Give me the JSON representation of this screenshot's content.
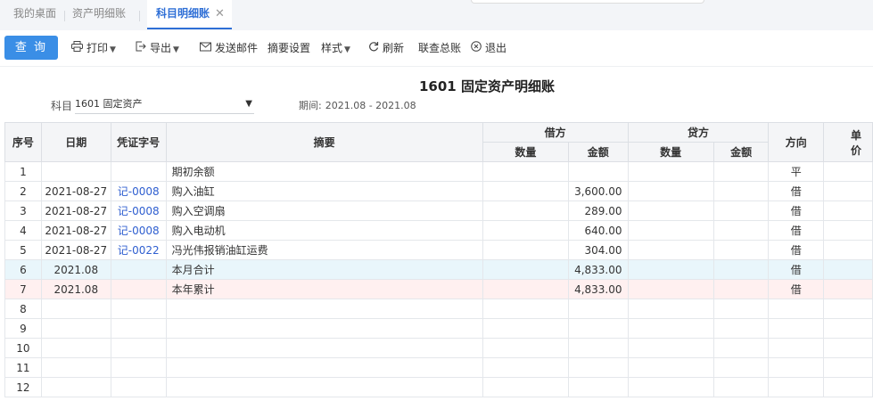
{
  "tabs": [
    {
      "label": "我的桌面"
    },
    {
      "label": "资产明细账"
    },
    {
      "label": "科目明细账",
      "close": "✕"
    }
  ],
  "toolbar": {
    "query": "查 询",
    "print": "打印",
    "export": "导出",
    "send_mail": "发送邮件",
    "summary_settings": "摘要设置",
    "style": "样式",
    "refresh": "刷新",
    "ledger": "联查总账",
    "exit": "退出"
  },
  "report": {
    "title": "1601 固定资产明细账",
    "subject_label": "科目",
    "subject_value": "1601 固定资产",
    "period_label": "期间:",
    "period_value": "2021.08 - 2021.08"
  },
  "table": {
    "headers": {
      "seq": "序号",
      "date": "日期",
      "voucher": "凭证字号",
      "summary": "摘要",
      "debit": "借方",
      "credit": "贷方",
      "qty": "数量",
      "amount": "金额",
      "direction": "方向",
      "unit": "单价"
    },
    "rows": [
      {
        "seq": "1",
        "date": "",
        "voucher": "",
        "summary": "期初余额",
        "d_qty": "",
        "d_amt": "",
        "c_qty": "",
        "c_amt": "",
        "dir": "平"
      },
      {
        "seq": "2",
        "date": "2021-08-27",
        "voucher": "记-0008",
        "summary": "购入油缸",
        "d_qty": "",
        "d_amt": "3,600.00",
        "c_qty": "",
        "c_amt": "",
        "dir": "借"
      },
      {
        "seq": "3",
        "date": "2021-08-27",
        "voucher": "记-0008",
        "summary": "购入空调扇",
        "d_qty": "",
        "d_amt": "289.00",
        "c_qty": "",
        "c_amt": "",
        "dir": "借"
      },
      {
        "seq": "4",
        "date": "2021-08-27",
        "voucher": "记-0008",
        "summary": "购入电动机",
        "d_qty": "",
        "d_amt": "640.00",
        "c_qty": "",
        "c_amt": "",
        "dir": "借"
      },
      {
        "seq": "5",
        "date": "2021-08-27",
        "voucher": "记-0022",
        "summary": "冯光伟报销油缸运费",
        "d_qty": "",
        "d_amt": "304.00",
        "c_qty": "",
        "c_amt": "",
        "dir": "借"
      },
      {
        "seq": "6",
        "date": "2021.08",
        "voucher": "",
        "summary": "本月合计",
        "d_qty": "",
        "d_amt": "4,833.00",
        "c_qty": "",
        "c_amt": "",
        "dir": "借"
      },
      {
        "seq": "7",
        "date": "2021.08",
        "voucher": "",
        "summary": "本年累计",
        "d_qty": "",
        "d_amt": "4,833.00",
        "c_qty": "",
        "c_amt": "",
        "dir": "借"
      },
      {
        "seq": "8",
        "date": "",
        "voucher": "",
        "summary": "",
        "d_qty": "",
        "d_amt": "",
        "c_qty": "",
        "c_amt": "",
        "dir": ""
      },
      {
        "seq": "9",
        "date": "",
        "voucher": "",
        "summary": "",
        "d_qty": "",
        "d_amt": "",
        "c_qty": "",
        "c_amt": "",
        "dir": ""
      },
      {
        "seq": "10",
        "date": "",
        "voucher": "",
        "summary": "",
        "d_qty": "",
        "d_amt": "",
        "c_qty": "",
        "c_amt": "",
        "dir": ""
      },
      {
        "seq": "11",
        "date": "",
        "voucher": "",
        "summary": "",
        "d_qty": "",
        "d_amt": "",
        "c_qty": "",
        "c_amt": "",
        "dir": ""
      },
      {
        "seq": "12",
        "date": "",
        "voucher": "",
        "summary": "",
        "d_qty": "",
        "d_amt": "",
        "c_qty": "",
        "c_amt": "",
        "dir": ""
      }
    ]
  },
  "colors": {
    "accent": "#3a8ee6",
    "link": "#2f5fd0",
    "subtotal_row": "#e9f6fb",
    "cumulative_row": "#fff0f0"
  },
  "icons": [
    "printer-icon",
    "export-icon",
    "mail-icon",
    "refresh-icon",
    "exit-icon",
    "chevron-down-icon",
    "close-icon"
  ]
}
